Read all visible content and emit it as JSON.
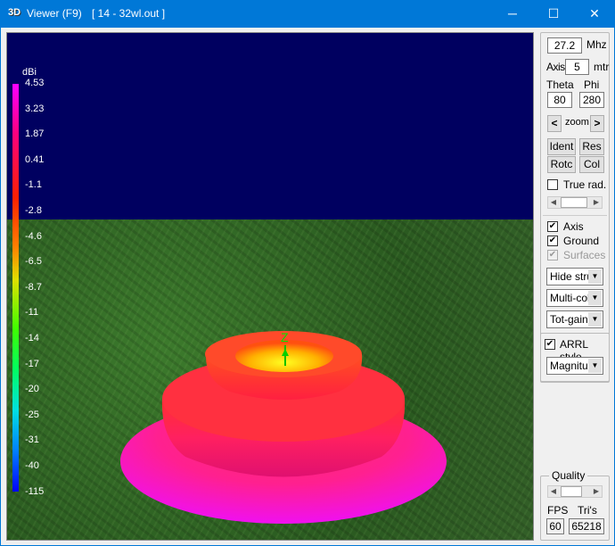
{
  "window": {
    "icon_text": "3D",
    "title": "Viewer (F9)",
    "file": "[  14 - 32wl.out ]",
    "minimize": "─",
    "maximize": "☐",
    "close": "✕"
  },
  "legend": {
    "unit": "dBi",
    "values": [
      "4.53",
      "3.23",
      "1.87",
      "0.41",
      "-1.1",
      "-2.8",
      "-4.6",
      "-6.5",
      "-8.7",
      "-11",
      "-14",
      "-17",
      "-20",
      "-25",
      "-31",
      "-40",
      "-115"
    ]
  },
  "axis_label": "Z",
  "panel": {
    "freq": "27.2",
    "freq_unit": "Mhz",
    "axis_label": "Axis",
    "axis_value": "5",
    "axis_unit": "mtr",
    "theta_label": "Theta",
    "phi_label": "Phi",
    "theta": "80",
    "phi": "280",
    "zoom_prev": "<",
    "zoom_label": "zoom",
    "zoom_next": ">",
    "ident": "Ident",
    "res": "Res",
    "rotc": "Rotc",
    "col": "Col",
    "true_rad": "True rad.",
    "chk_axis": "Axis",
    "chk_ground": "Ground",
    "chk_surfaces": "Surfaces",
    "sel_structure": "Hide struc",
    "sel_color": "Multi-colo",
    "sel_gain": "Tot-gain",
    "arrl": "ARRL style",
    "sel_mag": "Magnitud",
    "quality": "Quality",
    "fps_label": "FPS",
    "tris_label": "Tri's",
    "fps": "60",
    "tris": "65218"
  }
}
